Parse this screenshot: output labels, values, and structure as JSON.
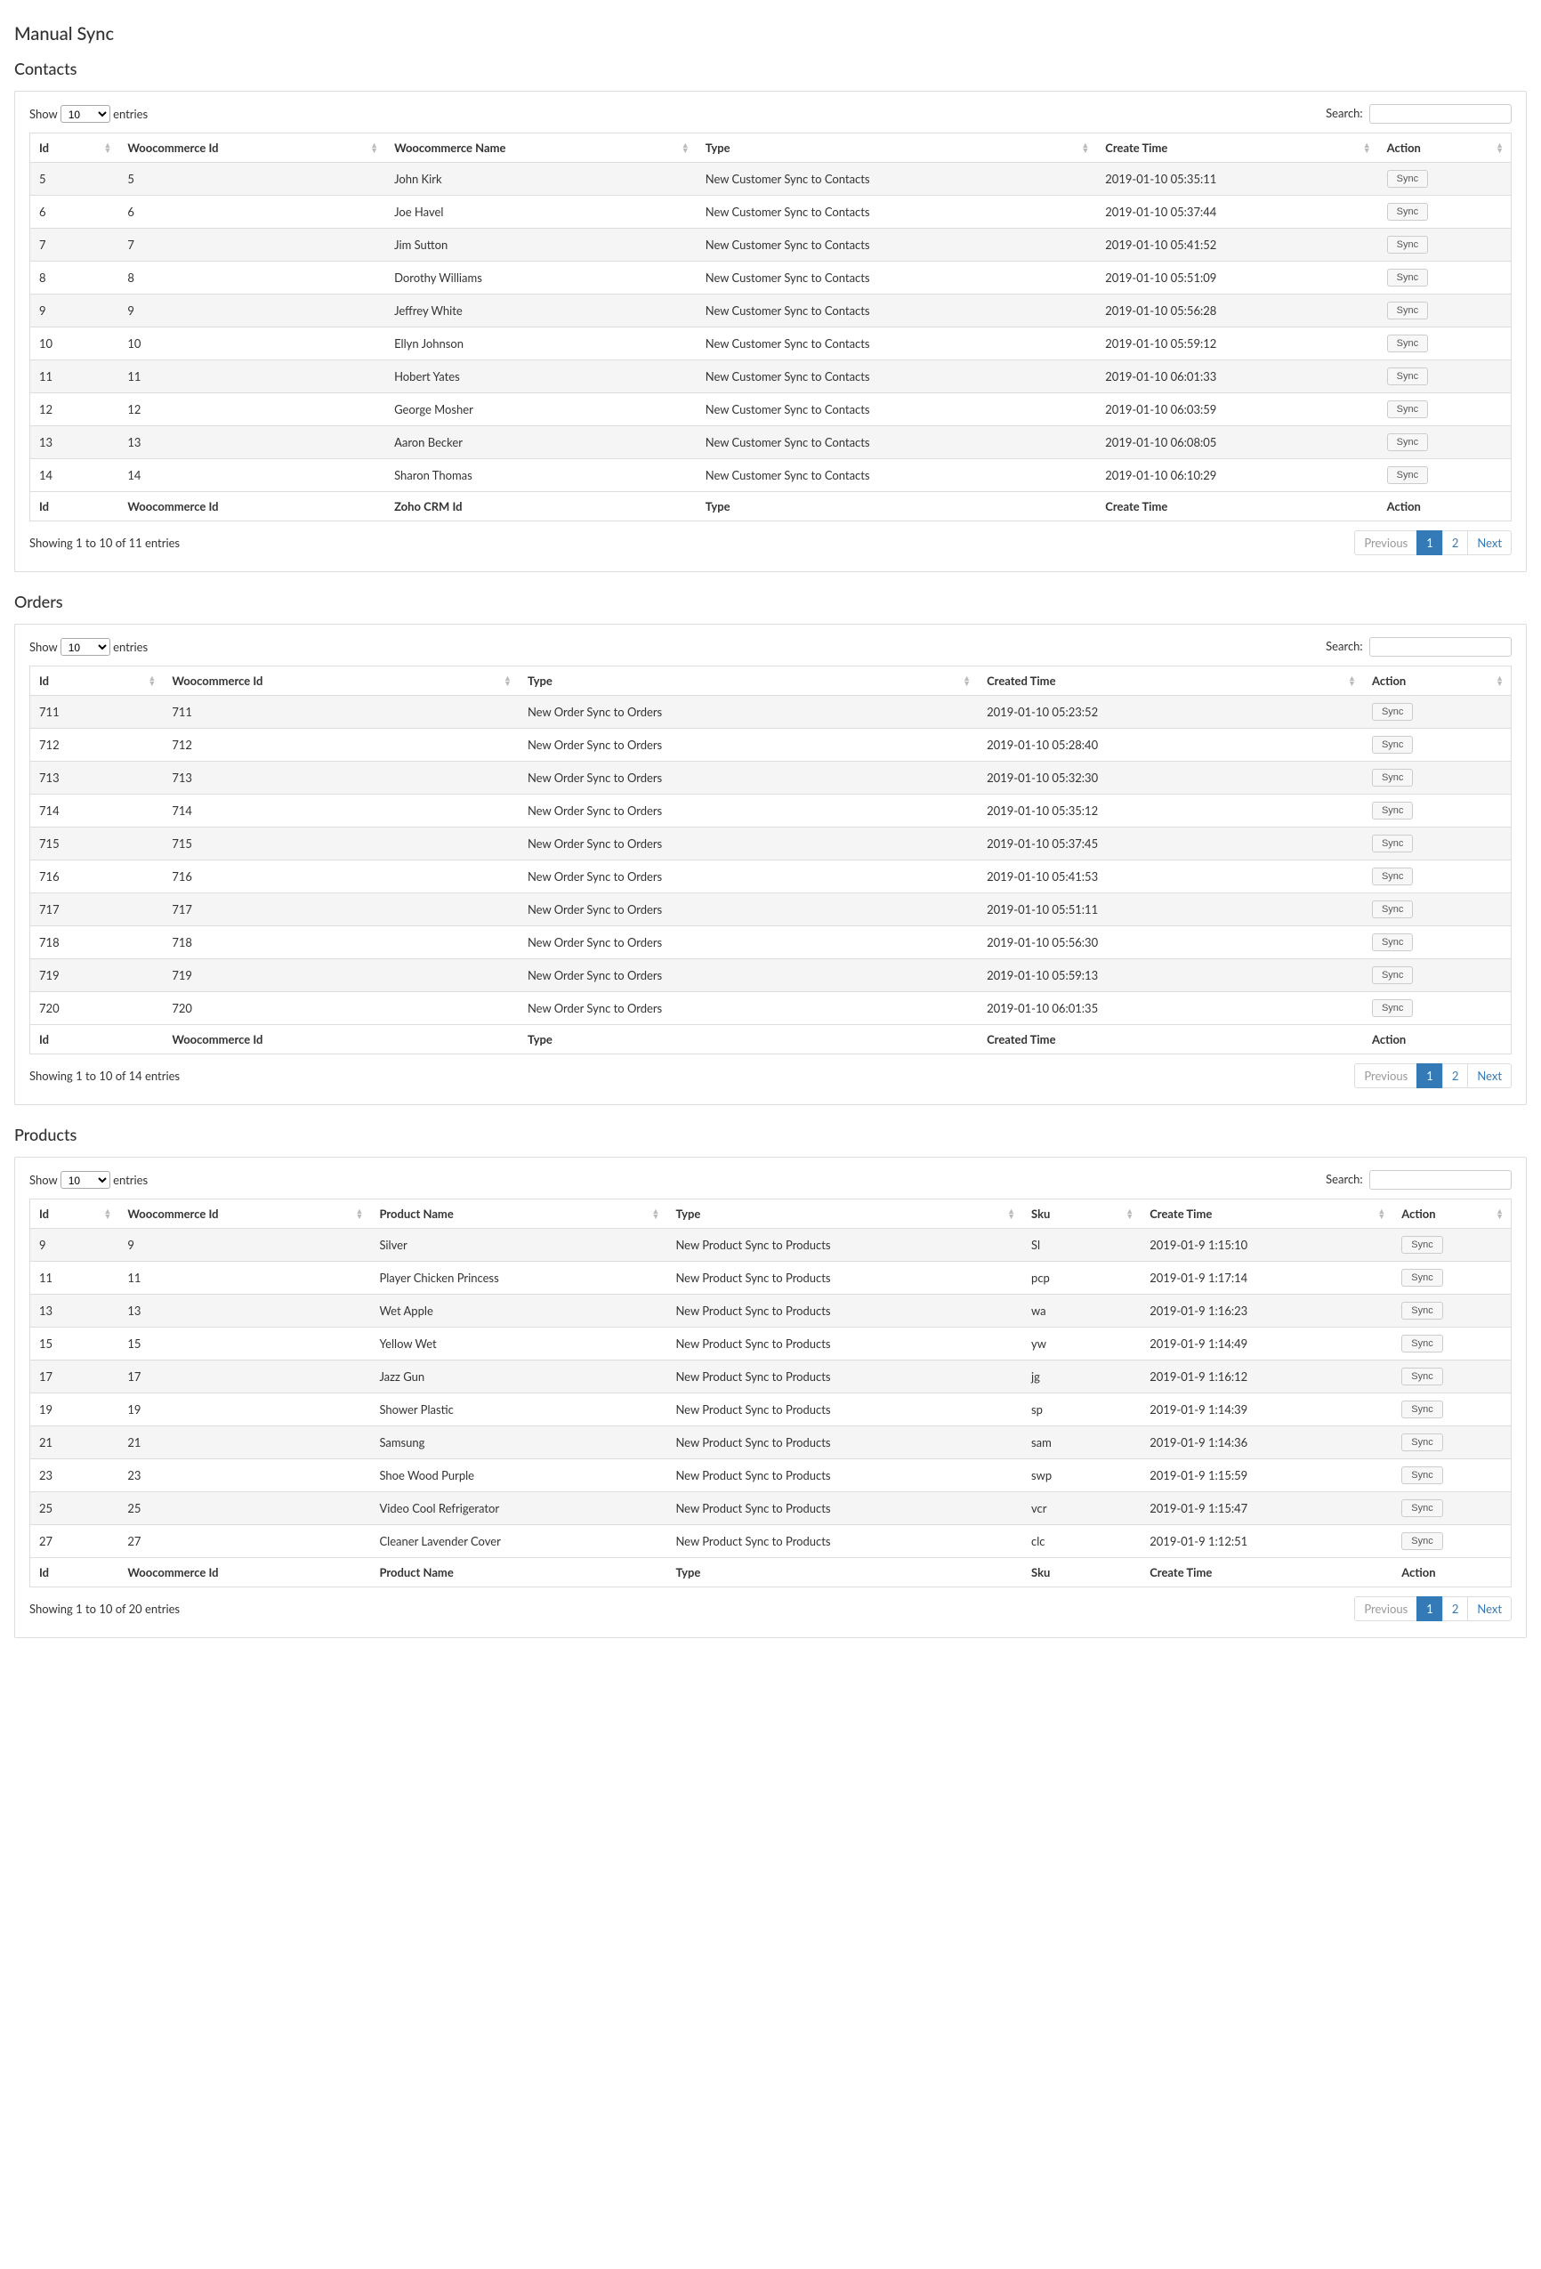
{
  "page_title": "Manual Sync",
  "labels": {
    "show": "Show",
    "entries": "entries",
    "search": "Search:",
    "sync": "Sync",
    "previous": "Previous",
    "next": "Next",
    "page1": "1",
    "page2": "2"
  },
  "length_options": "10",
  "contacts": {
    "title": "Contacts",
    "headers": [
      "Id",
      "Woocommerce Id",
      "Woocommerce Name",
      "Type",
      "Create Time",
      "Action"
    ],
    "footer_headers": [
      "Id",
      "Woocommerce Id",
      "Zoho CRM Id",
      "Type",
      "Create Time",
      "Action"
    ],
    "info": "Showing 1 to 10 of 11 entries",
    "rows": [
      {
        "id": "5",
        "wc": "5",
        "name": "John Kirk",
        "type": "New Customer Sync to Contacts",
        "time": "2019-01-10 05:35:11"
      },
      {
        "id": "6",
        "wc": "6",
        "name": "Joe Havel",
        "type": "New Customer Sync to Contacts",
        "time": "2019-01-10 05:37:44"
      },
      {
        "id": "7",
        "wc": "7",
        "name": "Jim Sutton",
        "type": "New Customer Sync to Contacts",
        "time": "2019-01-10 05:41:52"
      },
      {
        "id": "8",
        "wc": "8",
        "name": "Dorothy Williams",
        "type": "New Customer Sync to Contacts",
        "time": "2019-01-10 05:51:09"
      },
      {
        "id": "9",
        "wc": "9",
        "name": "Jeffrey White",
        "type": "New Customer Sync to Contacts",
        "time": "2019-01-10 05:56:28"
      },
      {
        "id": "10",
        "wc": "10",
        "name": "Ellyn Johnson",
        "type": "New Customer Sync to Contacts",
        "time": "2019-01-10 05:59:12"
      },
      {
        "id": "11",
        "wc": "11",
        "name": "Hobert Yates",
        "type": "New Customer Sync to Contacts",
        "time": "2019-01-10 06:01:33"
      },
      {
        "id": "12",
        "wc": "12",
        "name": "George Mosher",
        "type": "New Customer Sync to Contacts",
        "time": "2019-01-10 06:03:59"
      },
      {
        "id": "13",
        "wc": "13",
        "name": "Aaron Becker",
        "type": "New Customer Sync to Contacts",
        "time": "2019-01-10 06:08:05"
      },
      {
        "id": "14",
        "wc": "14",
        "name": "Sharon Thomas",
        "type": "New Customer Sync to Contacts",
        "time": "2019-01-10 06:10:29"
      }
    ]
  },
  "orders": {
    "title": "Orders",
    "headers": [
      "Id",
      "Woocommerce Id",
      "Type",
      "Created Time",
      "Action"
    ],
    "footer_headers": [
      "Id",
      "Woocommerce Id",
      "Type",
      "Created Time",
      "Action"
    ],
    "info": "Showing 1 to 10 of 14 entries",
    "rows": [
      {
        "id": "711",
        "wc": "711",
        "type": "New Order Sync to Orders",
        "time": "2019-01-10 05:23:52"
      },
      {
        "id": "712",
        "wc": "712",
        "type": "New Order Sync to Orders",
        "time": "2019-01-10 05:28:40"
      },
      {
        "id": "713",
        "wc": "713",
        "type": "New Order Sync to Orders",
        "time": "2019-01-10 05:32:30"
      },
      {
        "id": "714",
        "wc": "714",
        "type": "New Order Sync to Orders",
        "time": "2019-01-10 05:35:12"
      },
      {
        "id": "715",
        "wc": "715",
        "type": "New Order Sync to Orders",
        "time": "2019-01-10 05:37:45"
      },
      {
        "id": "716",
        "wc": "716",
        "type": "New Order Sync to Orders",
        "time": "2019-01-10 05:41:53"
      },
      {
        "id": "717",
        "wc": "717",
        "type": "New Order Sync to Orders",
        "time": "2019-01-10 05:51:11"
      },
      {
        "id": "718",
        "wc": "718",
        "type": "New Order Sync to Orders",
        "time": "2019-01-10 05:56:30"
      },
      {
        "id": "719",
        "wc": "719",
        "type": "New Order Sync to Orders",
        "time": "2019-01-10 05:59:13"
      },
      {
        "id": "720",
        "wc": "720",
        "type": "New Order Sync to Orders",
        "time": "2019-01-10 06:01:35"
      }
    ]
  },
  "products": {
    "title": "Products",
    "headers": [
      "Id",
      "Woocommerce Id",
      "Product Name",
      "Type",
      "Sku",
      "Create Time",
      "Action"
    ],
    "footer_headers": [
      "Id",
      "Woocommerce Id",
      "Product Name",
      "Type",
      "Sku",
      "Create Time",
      "Action"
    ],
    "info": "Showing 1 to 10 of 20 entries",
    "rows": [
      {
        "id": "9",
        "wc": "9",
        "name": "Silver",
        "type": "New Product Sync to Products",
        "sku": "Sl",
        "time": "2019-01-9 1:15:10"
      },
      {
        "id": "11",
        "wc": "11",
        "name": "Player Chicken Princess",
        "type": "New Product Sync to Products",
        "sku": "pcp",
        "time": "2019-01-9 1:17:14"
      },
      {
        "id": "13",
        "wc": "13",
        "name": "Wet Apple",
        "type": "New Product Sync to Products",
        "sku": "wa",
        "time": "2019-01-9 1:16:23"
      },
      {
        "id": "15",
        "wc": "15",
        "name": "Yellow Wet",
        "type": "New Product Sync to Products",
        "sku": "yw",
        "time": "2019-01-9 1:14:49"
      },
      {
        "id": "17",
        "wc": "17",
        "name": "Jazz Gun",
        "type": "New Product Sync to Products",
        "sku": "jg",
        "time": "2019-01-9 1:16:12"
      },
      {
        "id": "19",
        "wc": "19",
        "name": "Shower Plastic",
        "type": "New Product Sync to Products",
        "sku": "sp",
        "time": "2019-01-9 1:14:39"
      },
      {
        "id": "21",
        "wc": "21",
        "name": "Samsung",
        "type": "New Product Sync to Products",
        "sku": "sam",
        "time": "2019-01-9 1:14:36"
      },
      {
        "id": "23",
        "wc": "23",
        "name": "Shoe Wood Purple",
        "type": "New Product Sync to Products",
        "sku": "swp",
        "time": "2019-01-9 1:15:59"
      },
      {
        "id": "25",
        "wc": "25",
        "name": "Video Cool Refrigerator",
        "type": "New Product Sync to Products",
        "sku": "vcr",
        "time": "2019-01-9 1:15:47"
      },
      {
        "id": "27",
        "wc": "27",
        "name": "Cleaner Lavender Cover",
        "type": "New Product Sync to Products",
        "sku": "clc",
        "time": "2019-01-9 1:12:51"
      }
    ]
  }
}
